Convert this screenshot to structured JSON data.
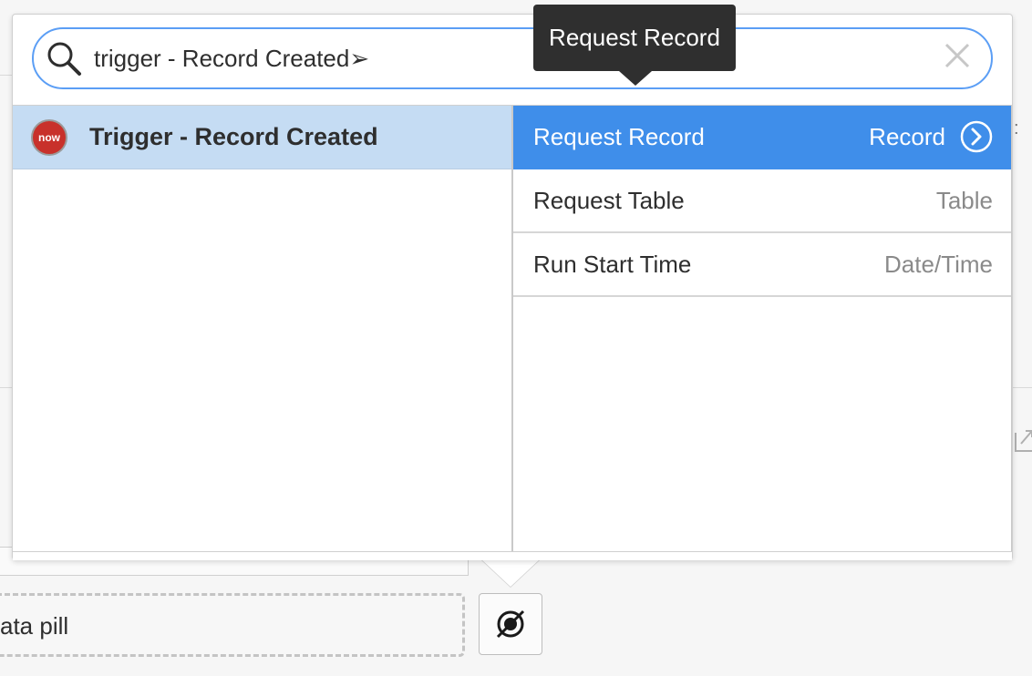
{
  "background": {
    "datapill_label": "ata pill"
  },
  "search": {
    "value": "trigger - Record Created➢",
    "placeholder": ""
  },
  "tooltip": {
    "text": "Request Record"
  },
  "sources": [
    {
      "label": "Trigger - Record Created",
      "logo_text": "now",
      "selected": true
    }
  ],
  "fields": [
    {
      "label": "Request Record",
      "type": "Record",
      "selected": true,
      "has_drill": true
    },
    {
      "label": "Request Table",
      "type": "Table",
      "selected": false,
      "has_drill": false
    },
    {
      "label": "Run Start Time",
      "type": "Date/Time",
      "selected": false,
      "has_drill": false
    }
  ],
  "colors": {
    "accent": "#3f8eea",
    "selected_source_bg": "#c5dcf3",
    "search_border": "#5b9ef5",
    "tooltip_bg": "#2f2f2f",
    "now_logo": "#c8312b"
  },
  "icons": {
    "search": "magnifier",
    "clear": "x",
    "drill": "circle-chevron-right",
    "picker": "data-pill-picker"
  }
}
